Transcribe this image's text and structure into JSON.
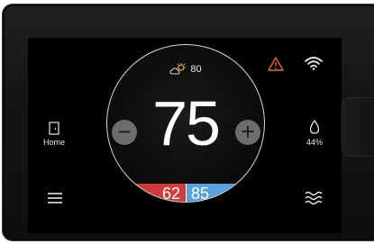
{
  "weather": {
    "temperature": "80",
    "icon": "partly-sunny-icon"
  },
  "setpoint": "75",
  "controls": {
    "decrease_label": "−",
    "increase_label": "+"
  },
  "range": {
    "heat": "62",
    "cool": "85",
    "heat_color": "#d23b3b",
    "cool_color": "#58a2e0"
  },
  "status": {
    "alert_icon": "warning-icon",
    "alert_color": "#e26a2c",
    "wifi_icon": "wifi-icon"
  },
  "home": {
    "label": "Home",
    "icon": "door-icon"
  },
  "humidity": {
    "value": "44%",
    "icon": "water-drop-icon"
  },
  "menu": {
    "icon": "menu-icon"
  },
  "fan": {
    "icon": "fan-waves-icon"
  }
}
